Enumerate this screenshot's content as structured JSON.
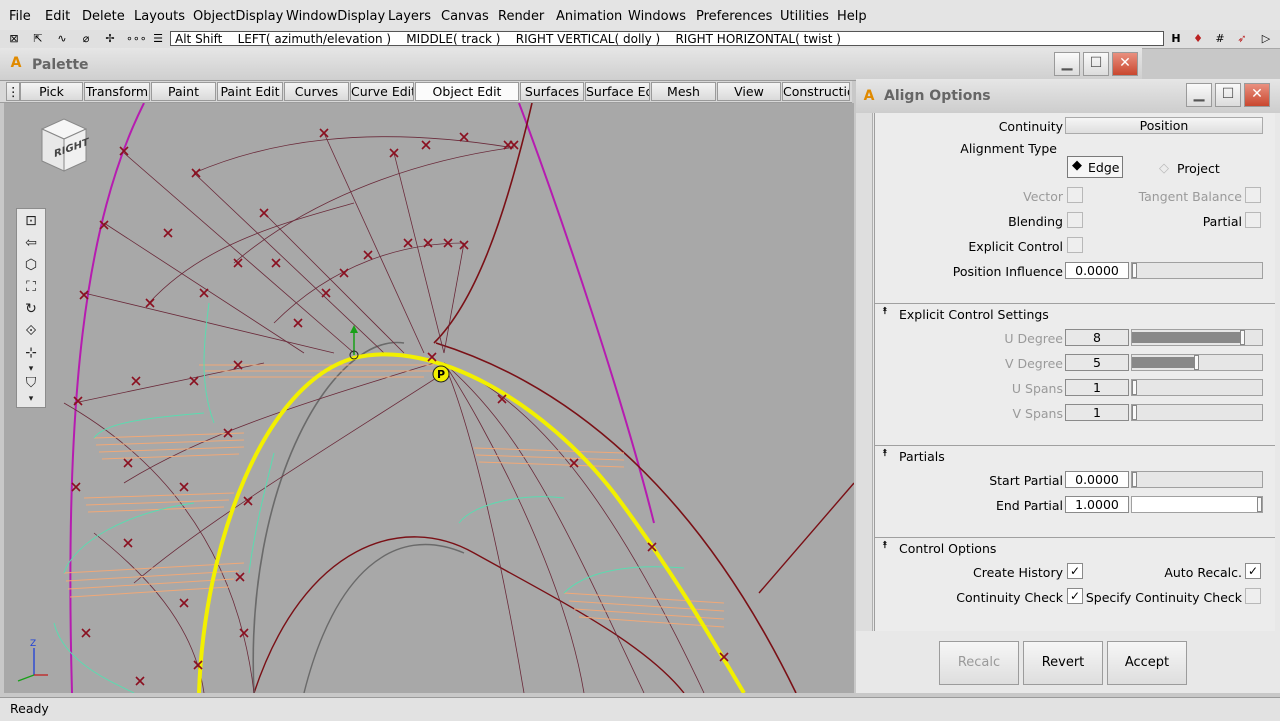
{
  "menu": [
    "File",
    "Edit",
    "Delete",
    "Layouts",
    "ObjectDisplay",
    "WindowDisplay",
    "Layers",
    "Canvas",
    "Render",
    "Animation",
    "Windows",
    "Preferences",
    "Utilities",
    "Help"
  ],
  "toolbar": {
    "hint": "Alt Shift    LEFT( azimuth/elevation )    MIDDLE( track )    RIGHT VERTICAL( dolly )    RIGHT HORIZONTAL( twist )",
    "left_icons": [
      "grid-icon",
      "move-icon",
      "curve-icon",
      "snap-icon",
      "pivot-icon",
      "dots-icon",
      "list-icon"
    ],
    "right_icons": [
      "history-icon",
      "magnet-icon",
      "grid-snap-icon",
      "arrow-icon",
      "play-icon"
    ]
  },
  "palette": {
    "title": "Palette",
    "tabs": [
      "Pick",
      "Transform",
      "Paint",
      "Paint Edit",
      "Curves",
      "Curve Edit",
      "Object Edit",
      "Surfaces",
      "Surface Edit",
      "Mesh",
      "View",
      "Construction"
    ],
    "active_tab": "Object Edit"
  },
  "viewport": {
    "cube_label": "RIGHT",
    "point_label": "P",
    "tool_icons": [
      "frame-icon",
      "back-icon",
      "cube-icon",
      "zoom-fit-icon",
      "orbit-icon",
      "tumble-icon",
      "lock-axes-icon",
      "dropdown-icon",
      "bookmark-icon",
      "dropdown-icon"
    ]
  },
  "align_options": {
    "title": "Align Options",
    "continuity_label": "Continuity",
    "continuity_value": "Position",
    "alignment_type_label": "Alignment Type",
    "edge_label": "Edge",
    "project_label": "Project",
    "vector_label": "Vector",
    "tangent_balance_label": "Tangent Balance",
    "blending_label": "Blending",
    "partial_label": "Partial",
    "explicit_control_label": "Explicit Control",
    "position_influence_label": "Position Influence",
    "position_influence_value": "0.0000",
    "explicit_section": "Explicit Control Settings",
    "u_degree_label": "U Degree",
    "u_degree_value": "8",
    "u_degree_fill": 0.85,
    "v_degree_label": "V Degree",
    "v_degree_value": "5",
    "v_degree_fill": 0.5,
    "u_spans_label": "U Spans",
    "u_spans_value": "1",
    "v_spans_label": "V Spans",
    "v_spans_value": "1",
    "partials_section": "Partials",
    "start_partial_label": "Start Partial",
    "start_partial_value": "0.0000",
    "end_partial_label": "End Partial",
    "end_partial_value": "1.0000",
    "control_section": "Control Options",
    "create_history_label": "Create History",
    "create_history_checked": "✓",
    "auto_recalc_label": "Auto Recalc.",
    "auto_recalc_checked": "✓",
    "continuity_check_label": "Continuity Check",
    "continuity_check_checked": "✓",
    "specify_continuity_label": "Specify Continuity Check",
    "recalc_label": "Recalc",
    "revert_label": "Revert",
    "accept_label": "Accept"
  },
  "status": "Ready",
  "colors": {
    "curve_yellow": "#f2f000",
    "curve_magenta": "#b61cb0",
    "curve_dark_red": "#7a1016",
    "cv_marker": "#8a1020",
    "mesh_line": "#6a2a3a",
    "peach": "#f0a878",
    "teal": "#5adcb0"
  }
}
